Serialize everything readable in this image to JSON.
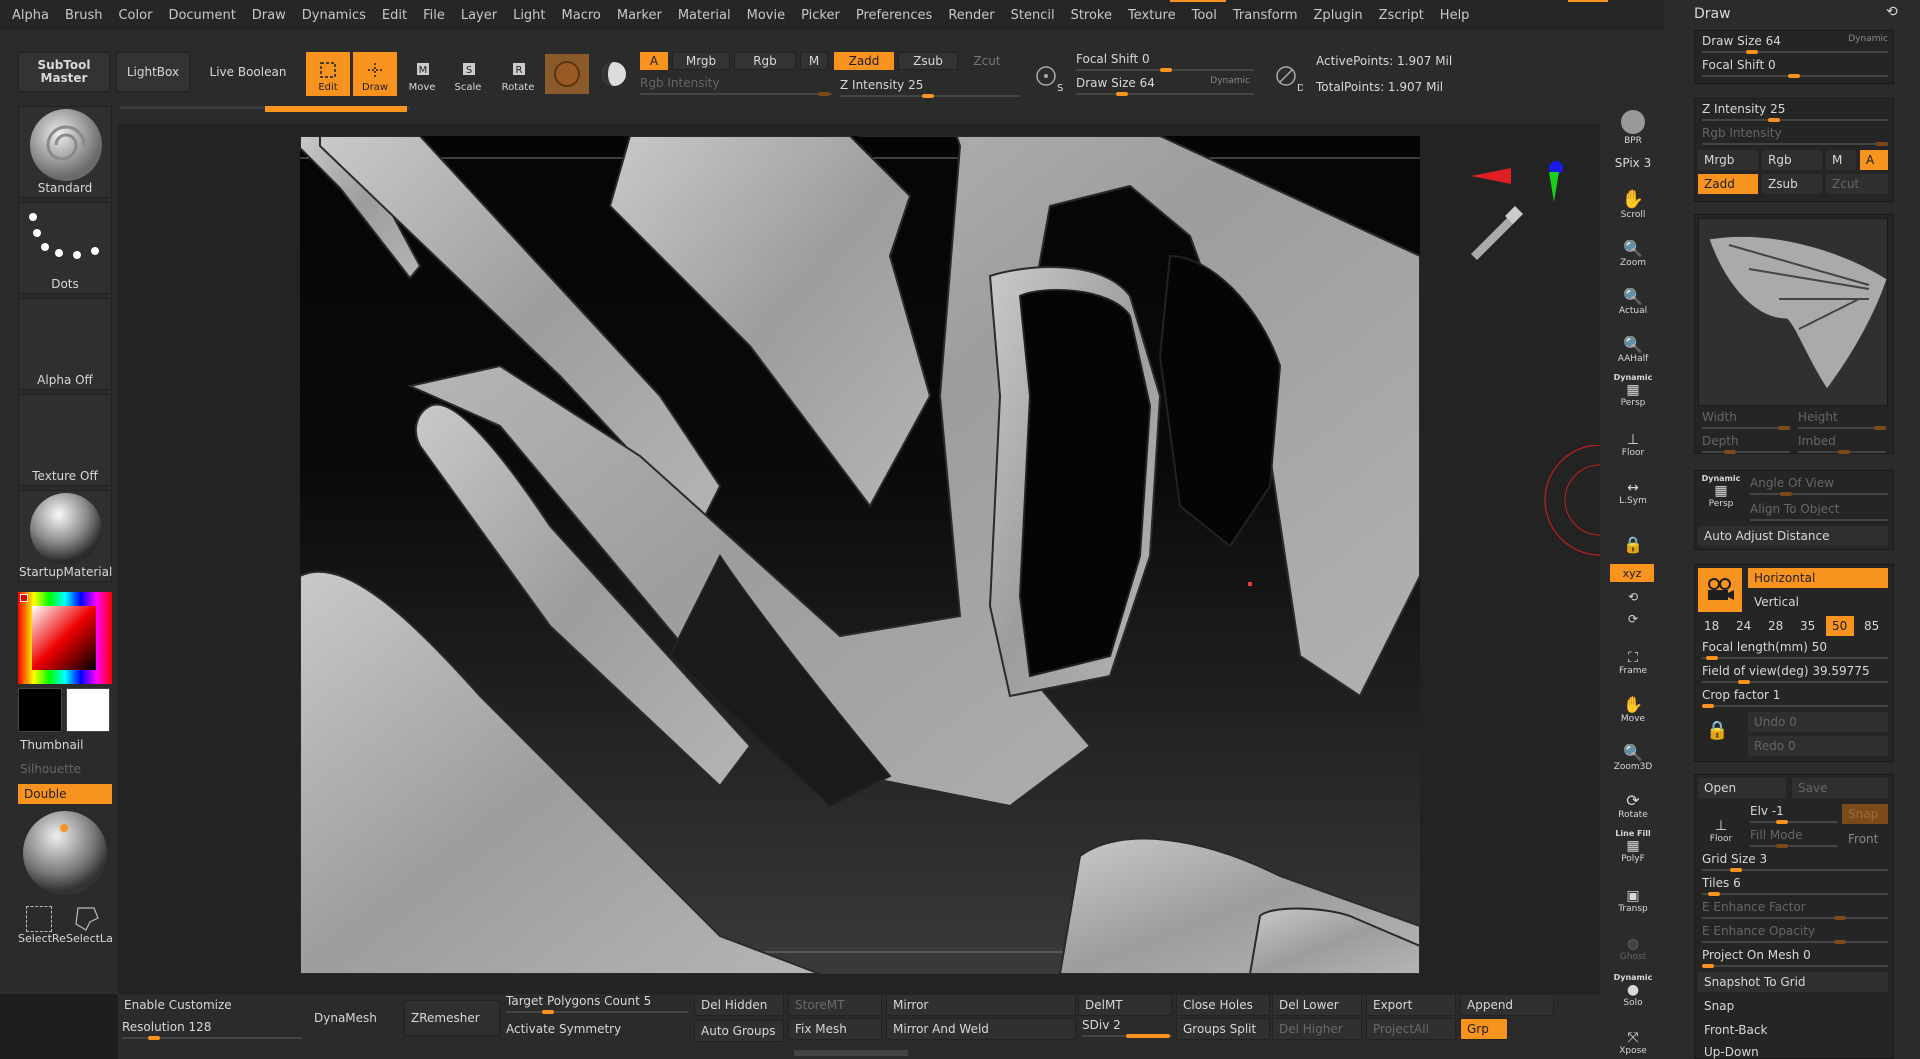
{
  "menu": [
    "Alpha",
    "Brush",
    "Color",
    "Document",
    "Draw",
    "Dynamics",
    "Edit",
    "File",
    "Layer",
    "Light",
    "Macro",
    "Marker",
    "Material",
    "Movie",
    "Picker",
    "Preferences",
    "Render",
    "Stencil",
    "Stroke",
    "Texture",
    "Tool",
    "Transform",
    "Zplugin",
    "Zscript",
    "Help"
  ],
  "topshelf": {
    "subtool_master_1": "SubTool",
    "subtool_master_2": "Master",
    "lightbox": "LightBox",
    "live_boolean": "Live Boolean",
    "edit": "Edit",
    "draw": "Draw",
    "move": "Move",
    "scale": "Scale",
    "rotate": "Rotate",
    "a": "A",
    "mrgb": "Mrgb",
    "rgb": "Rgb",
    "m": "M",
    "zadd": "Zadd",
    "zsub": "Zsub",
    "zcut": "Zcut",
    "rgb_intensity": "Rgb Intensity",
    "z_intensity": "Z Intensity 25",
    "focal_shift": "Focal Shift 0",
    "draw_size": "Draw Size 64",
    "dynamic": "Dynamic",
    "active_points": "ActivePoints: 1.907 Mil",
    "total_points": "TotalPoints: 1.907 Mil",
    "s_key": "S",
    "d_key": "D"
  },
  "leftshelf": {
    "standard": "Standard",
    "dots": "Dots",
    "alpha_off": "Alpha Off",
    "texture_off": "Texture Off",
    "startup_material": "StartupMaterial",
    "thumbnail": "Thumbnail",
    "silhouette": "Silhouette",
    "double": "Double",
    "select_rect": "SelectRe",
    "select_lasso": "SelectLa"
  },
  "rightshelf": {
    "bpr": "BPR",
    "spix": "SPix 3",
    "scroll": "Scroll",
    "zoom": "Zoom",
    "actual": "Actual",
    "aahalf": "AAHalf",
    "dynamic": "Dynamic",
    "persp": "Persp",
    "floor": "Floor",
    "lsym": "L.Sym",
    "xyz": "xyz",
    "frame": "Frame",
    "move": "Move",
    "zoom3d": "Zoom3D",
    "rotate": "Rotate",
    "linefill": "Line Fill",
    "polyf": "PolyF",
    "transp": "Transp",
    "ghost": "Ghost",
    "solo": "Solo",
    "xpose": "Xpose"
  },
  "tray": {
    "title": "Draw",
    "draw_size": "Draw Size 64",
    "dynamic": "Dynamic",
    "focal_shift": "Focal Shift 0",
    "z_intensity": "Z Intensity 25",
    "rgb_intensity": "Rgb Intensity",
    "mrgb": "Mrgb",
    "rgb": "Rgb",
    "m": "M",
    "a": "A",
    "zadd": "Zadd",
    "zsub": "Zsub",
    "zcut": "Zcut",
    "width": "Width",
    "height": "Height",
    "depth": "Depth",
    "imbed": "Imbed",
    "dyn": "Dynamic",
    "persp": "Persp",
    "angle_of_view": "Angle Of View",
    "align_to_object": "Align To Object",
    "auto_adjust_distance": "Auto Adjust Distance",
    "horizontal": "Horizontal",
    "vertical": "Vertical",
    "focal_presets": [
      "18",
      "24",
      "28",
      "35",
      "50",
      "85"
    ],
    "focal_length": "Focal length(mm) 50",
    "field_of_view": "Field of view(deg) 39.59775",
    "crop_factor": "Crop factor 1",
    "undo": "Undo 0",
    "redo": "Redo 0",
    "open": "Open",
    "save": "Save",
    "floor": "Floor",
    "elv": "Elv -1",
    "snap": "Snap",
    "fill_mode": "Fill Mode",
    "front": "Front",
    "grid_size": "Grid Size 3",
    "tiles": "Tiles 6",
    "e_enhance_factor": "E Enhance Factor",
    "e_enhance_opacity": "E Enhance Opacity",
    "project_on_mesh": "Project On Mesh 0",
    "snapshot_to_grid": "Snapshot To Grid",
    "snap2": "Snap",
    "front_back": "Front-Back",
    "up_down": "Up-Down"
  },
  "bottom": {
    "enable_customize": "Enable Customize",
    "resolution": "Resolution 128",
    "dynamesh": "DynaMesh",
    "zremesher": "ZRemesher",
    "target_polygons": "Target Polygons Count 5",
    "activate_symmetry": "Activate Symmetry",
    "del_hidden": "Del Hidden",
    "auto_groups": "Auto Groups",
    "storemt": "StoreMT",
    "fix_mesh": "Fix Mesh",
    "mirror": "Mirror",
    "mirror_and_weld": "Mirror And Weld",
    "delmt": "DelMT",
    "sdiv": "SDiv 2",
    "close_holes": "Close Holes",
    "groups_split": "Groups Split",
    "del_lower": "Del Lower",
    "del_higher": "Del Higher",
    "export": "Export",
    "projectall": "ProjectAll",
    "append": "Append",
    "grp": "Grp"
  },
  "colors": {
    "accent": "#f7931e",
    "panel": "#2b2b2b",
    "background": "#1e1e1e"
  }
}
